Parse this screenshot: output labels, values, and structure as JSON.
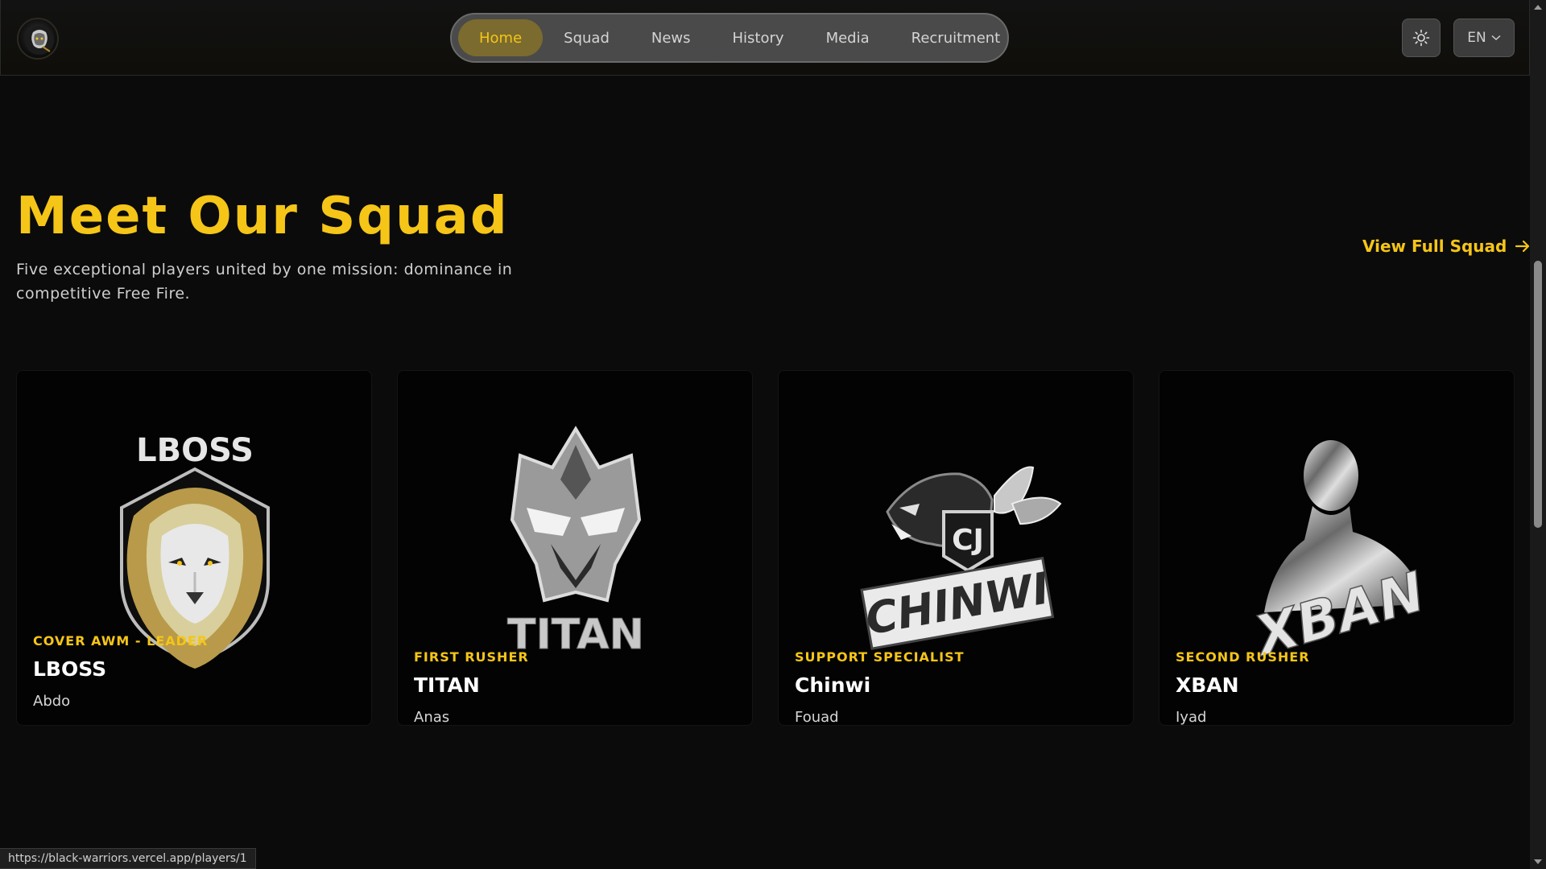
{
  "nav": {
    "items": [
      {
        "label": "Home",
        "active": true
      },
      {
        "label": "Squad",
        "active": false
      },
      {
        "label": "News",
        "active": false
      },
      {
        "label": "History",
        "active": false
      },
      {
        "label": "Media",
        "active": false
      },
      {
        "label": "Recruitment",
        "active": false
      }
    ],
    "language": "EN",
    "theme_icon": "sun-icon",
    "logo_icon": "lion-logo-icon"
  },
  "section": {
    "title": "Meet Our Squad",
    "description": "Five exceptional players united by one mission: dominance in competitive Free Fire.",
    "view_full_label": "View Full Squad"
  },
  "players": [
    {
      "role": "COVER AWM - LEADER",
      "gamer_tag": "LBOSS",
      "real_name": "Abdo",
      "emblem_text": "LBOSS",
      "emblem_icon": "lion-emblem"
    },
    {
      "role": "FIRST RUSHER",
      "gamer_tag": "TITAN",
      "real_name": "Anas",
      "emblem_text": "TITAN",
      "emblem_icon": "helmet-emblem"
    },
    {
      "role": "SUPPORT SPECIALIST",
      "gamer_tag": "Chinwi",
      "real_name": "Fouad",
      "emblem_text": "CHINWI",
      "emblem_icon": "panther-emblem"
    },
    {
      "role": "SECOND RUSHER",
      "gamer_tag": "XBAN",
      "real_name": "Iyad",
      "emblem_text": "XBAN",
      "emblem_icon": "chrome-bust-emblem"
    }
  ],
  "status_bar": {
    "url": "https://black-warriors.vercel.app/players/1"
  },
  "colors": {
    "accent": "#f5c518",
    "background": "#0b0b0b",
    "card": "#030303"
  }
}
